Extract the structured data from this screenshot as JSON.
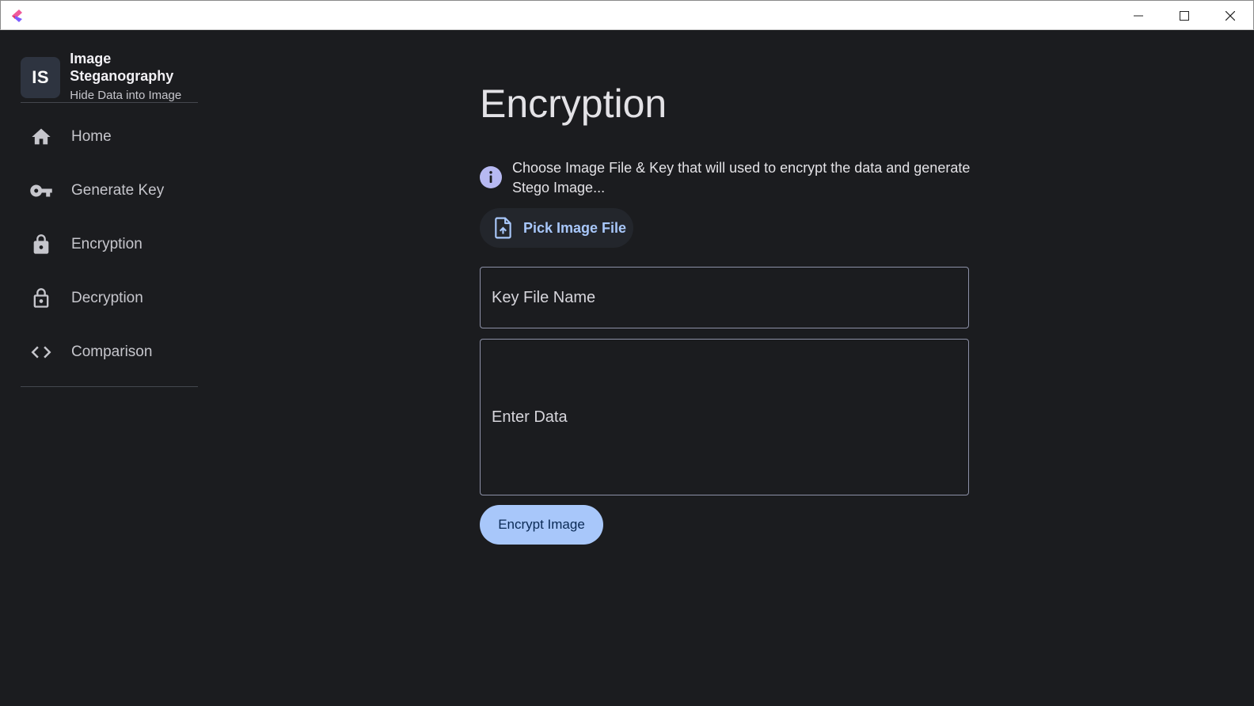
{
  "window": {
    "controls": {
      "minimize_icon": "minimize-icon",
      "maximize_icon": "maximize-icon",
      "close_icon": "close-icon"
    }
  },
  "sidebar": {
    "avatar_initials": "IS",
    "title": "Image Steganography",
    "subtitle": "Hide Data into Image",
    "items": [
      {
        "label": "Home",
        "icon": "home-icon"
      },
      {
        "label": "Generate Key",
        "icon": "key-icon"
      },
      {
        "label": "Encryption",
        "icon": "lock-icon"
      },
      {
        "label": "Decryption",
        "icon": "lock-open-icon"
      },
      {
        "label": "Comparison",
        "icon": "code-icon"
      }
    ]
  },
  "main": {
    "title": "Encryption",
    "info_text": "Choose Image File & Key that will used to encrypt the data and generate Stego Image...",
    "pick_button_label": "Pick Image File",
    "key_field_placeholder": "Key File Name",
    "data_field_placeholder": "Enter Data",
    "encrypt_button_label": "Encrypt Image"
  },
  "colors": {
    "background": "#1b1c1f",
    "accent": "#a8c7fa",
    "info_icon": "#b7b9f2",
    "field_border": "#8c90a6"
  }
}
